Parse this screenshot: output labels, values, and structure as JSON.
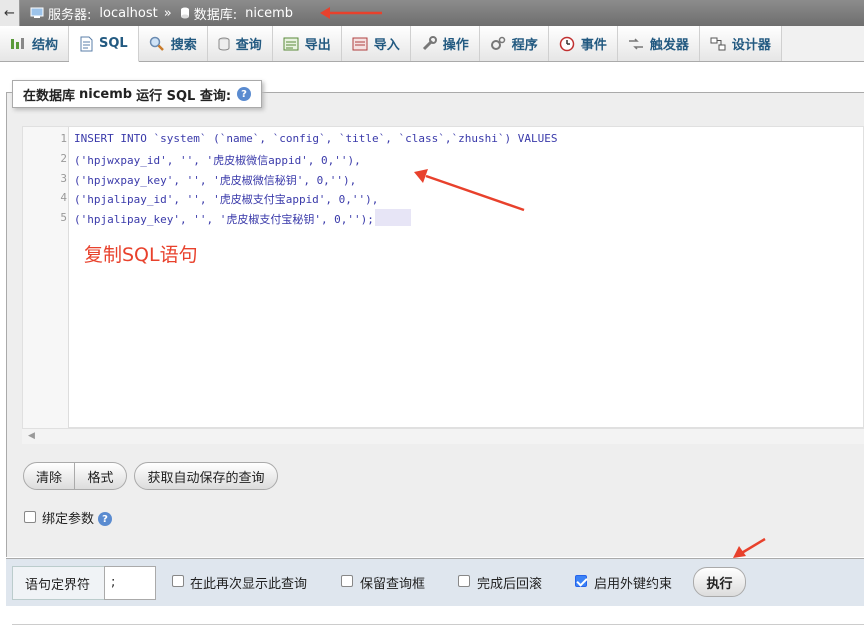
{
  "breadcrumb": {
    "back": "←",
    "server_label": "服务器:",
    "server_value": "localhost",
    "separator": "»",
    "db_label": "数据库:",
    "db_value": "nicemb"
  },
  "tabs": [
    {
      "label": "结构",
      "icon": "structure-icon"
    },
    {
      "label": "SQL",
      "icon": "sql-icon"
    },
    {
      "label": "搜索",
      "icon": "search-icon"
    },
    {
      "label": "查询",
      "icon": "query-icon"
    },
    {
      "label": "导出",
      "icon": "export-icon"
    },
    {
      "label": "导入",
      "icon": "import-icon"
    },
    {
      "label": "操作",
      "icon": "wrench-icon"
    },
    {
      "label": "程序",
      "icon": "routines-icon"
    },
    {
      "label": "事件",
      "icon": "clock-icon"
    },
    {
      "label": "触发器",
      "icon": "trigger-icon"
    },
    {
      "label": "设计器",
      "icon": "designer-icon"
    }
  ],
  "legend": {
    "prefix": "在数据库",
    "db": "nicemb",
    "suffix": "运行 SQL 查询:",
    "help": "?"
  },
  "editor": {
    "line_numbers": [
      "1",
      "2",
      "3",
      "4",
      "5"
    ],
    "lines": [
      "INSERT INTO `system` (`name`, `config`, `title`, `class`,`zhushi`) VALUES",
      "('hpjwxpay_id', '', '虎皮椒微信appid', 0,''),",
      "('hpjwxpay_key', '', '虎皮椒微信秘钥', 0,''),",
      "('hpjalipay_id', '', '虎皮椒支付宝appid', 0,''),",
      "('hpjalipay_key', '', '虎皮椒支付宝秘钥', 0,'');"
    ],
    "annotation": "复制SQL语句"
  },
  "buttons": {
    "clear": "清除",
    "format": "格式",
    "get_autosave": "获取自动保存的查询",
    "execute": "执行"
  },
  "bind_params": {
    "label": "绑定参数",
    "checked": false
  },
  "bottom": {
    "delimiter_label": "语句定界符",
    "delimiter_value": ";",
    "show_again": {
      "label": "在此再次显示此查询",
      "checked": false
    },
    "retain_box": {
      "label": "保留查询框",
      "checked": false
    },
    "rollback": {
      "label": "完成后回滚",
      "checked": false
    },
    "fk_checks": {
      "label": "启用外键约束",
      "checked": true
    }
  },
  "colors": {
    "accent": "#235a81",
    "annotation": "#e8412c",
    "checkbox_on": "#3b82f6"
  }
}
